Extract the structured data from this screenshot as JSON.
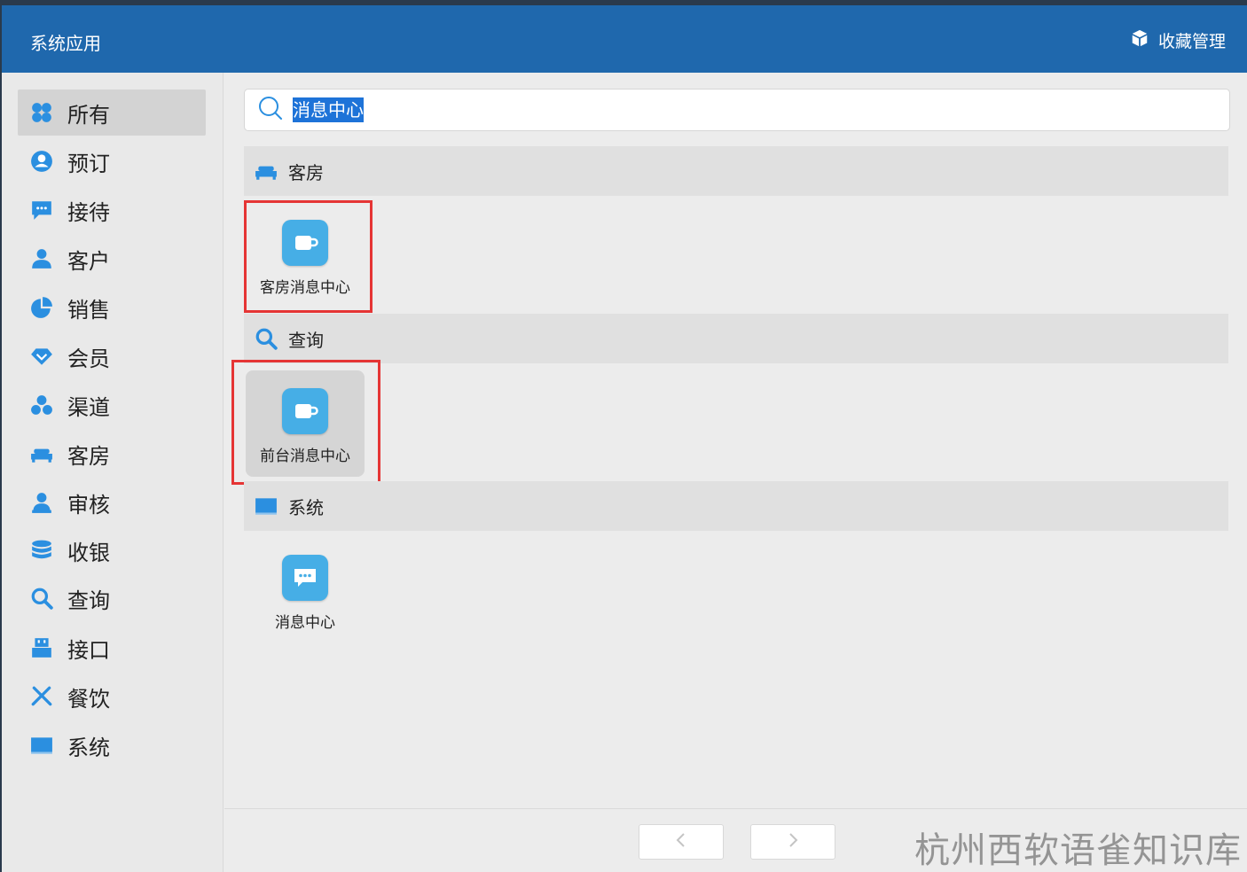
{
  "header": {
    "title": "系统应用",
    "favorites_label": "收藏管理"
  },
  "sidebar": {
    "items": [
      {
        "label": "所有",
        "icon": "grid-icon",
        "active": true
      },
      {
        "label": "预订",
        "icon": "user-circle-icon"
      },
      {
        "label": "接待",
        "icon": "chat-bubble-icon"
      },
      {
        "label": "客户",
        "icon": "person-icon"
      },
      {
        "label": "销售",
        "icon": "pie-chart-icon"
      },
      {
        "label": "会员",
        "icon": "diamond-icon"
      },
      {
        "label": "渠道",
        "icon": "cluster-icon"
      },
      {
        "label": "客房",
        "icon": "bed-icon"
      },
      {
        "label": "审核",
        "icon": "auditor-icon"
      },
      {
        "label": "收银",
        "icon": "database-icon"
      },
      {
        "label": "查询",
        "icon": "magnifier-icon"
      },
      {
        "label": "接口",
        "icon": "usb-icon"
      },
      {
        "label": "餐饮",
        "icon": "utensils-icon"
      },
      {
        "label": "系统",
        "icon": "monitor-icon"
      }
    ]
  },
  "search": {
    "value": "消息中心"
  },
  "groups": [
    {
      "label": "客房",
      "icon": "bed-icon",
      "apps": [
        {
          "label": "客房消息中心",
          "icon": "coffee-cup-icon"
        }
      ]
    },
    {
      "label": "查询",
      "icon": "magnifier-icon",
      "apps": [
        {
          "label": "前台消息中心",
          "icon": "coffee-cup-icon",
          "selected": true
        }
      ]
    },
    {
      "label": "系统",
      "icon": "monitor-icon",
      "apps": [
        {
          "label": "消息中心",
          "icon": "message-icon"
        }
      ]
    }
  ],
  "footer": {
    "prev_icon": "chevron-left-icon",
    "next_icon": "chevron-right-icon",
    "watermark": "杭州西软语雀知识库"
  },
  "colors": {
    "header": "#1f68ad",
    "accent": "#46aee6",
    "highlight": "#e53535",
    "selection": "#1e73d8"
  }
}
